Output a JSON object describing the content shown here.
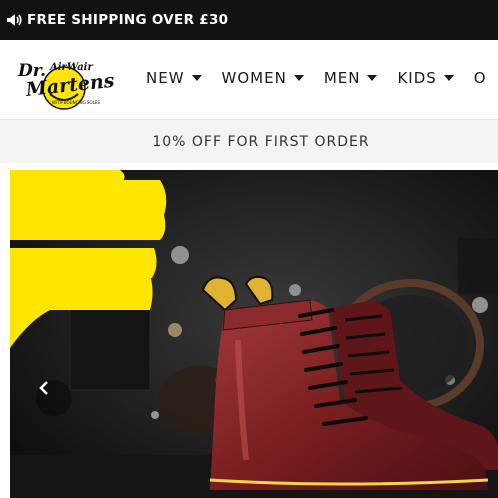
{
  "announcement": {
    "icon": "megaphone-icon",
    "text": "FREE SHIPPING OVER £30"
  },
  "logo": {
    "alt": "Dr. Martens AirWair"
  },
  "nav": {
    "items": [
      {
        "label": "NEW"
      },
      {
        "label": "WOMEN"
      },
      {
        "label": "MEN"
      },
      {
        "label": "KIDS"
      },
      {
        "label": "O"
      }
    ]
  },
  "promo": {
    "text": "10% OFF FOR FIRST ORDER"
  },
  "hero": {
    "prev_icon": "chevron-left-icon",
    "accent_color": "#ffe600",
    "boot_color": "#7a1e20"
  },
  "colors": {
    "top_bar": "#121212",
    "brand_yellow": "#ffe600",
    "promo_bg": "#f4f4f4"
  }
}
